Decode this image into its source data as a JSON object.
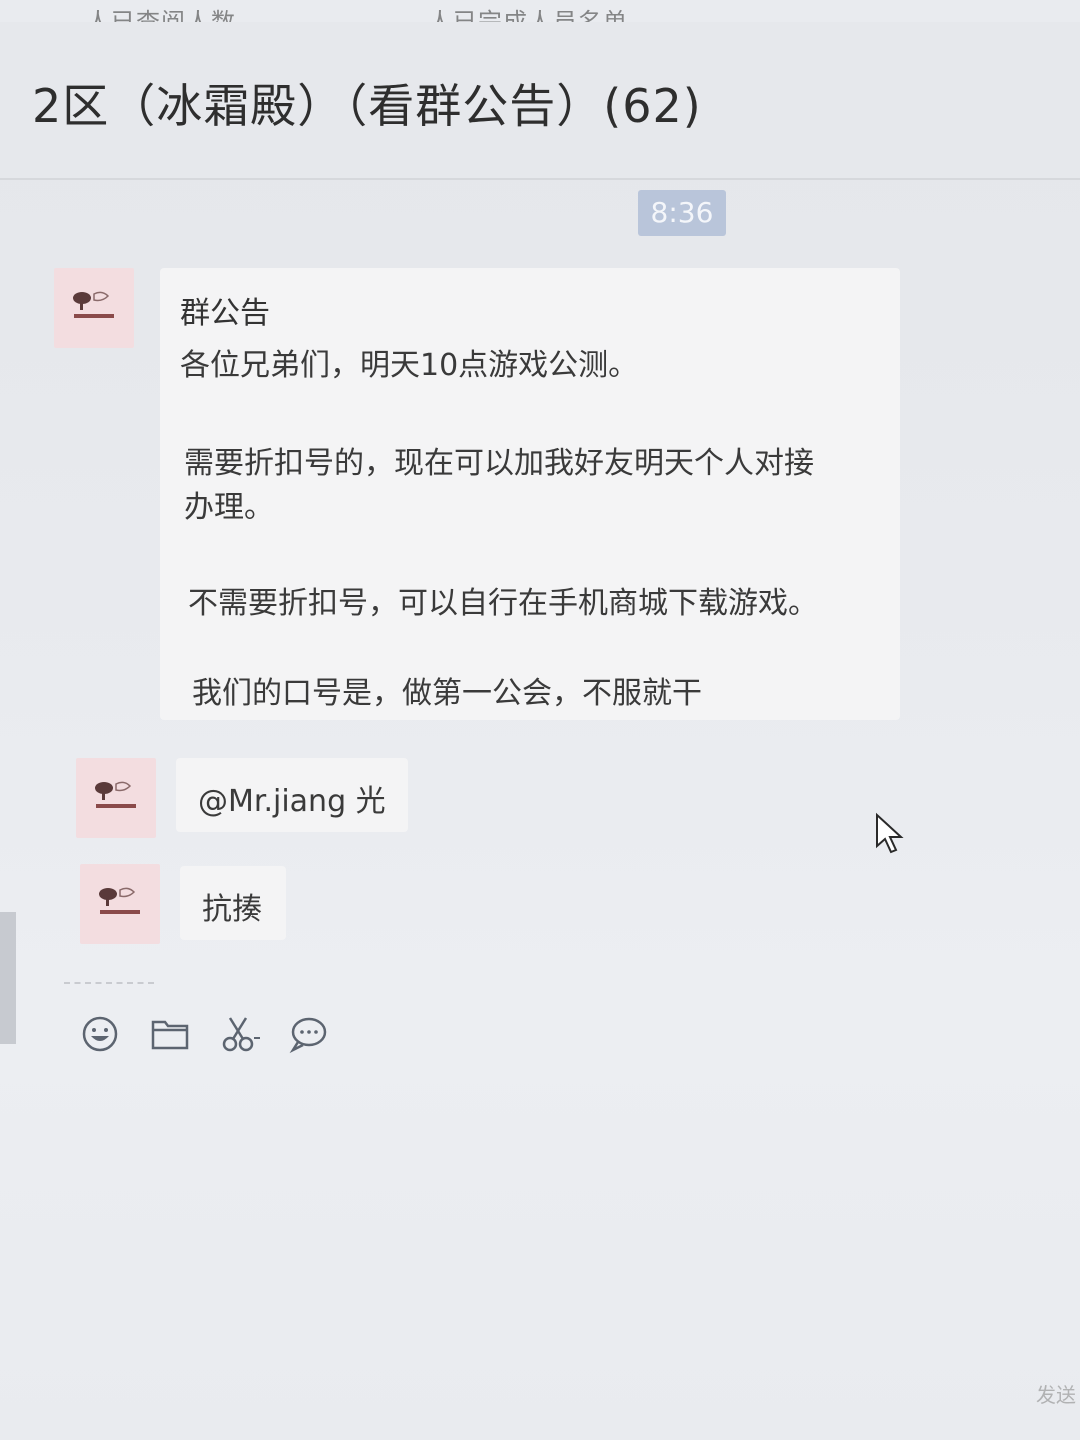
{
  "top_strip": {
    "left_text": "人已查阅人数",
    "right_text": "人已完成人员名单"
  },
  "chat": {
    "title": "2区（冰霜殿）（看群公告）(62)",
    "time": "8:36"
  },
  "announcement": {
    "heading": "群公告",
    "lines": [
      "各位兄弟们，明天10点游戏公测。",
      "需要折扣号的，现在可以加我好友明天个人对接",
      "办理。",
      "不需要折扣号，可以自行在手机商城下载游戏。",
      "我们的口号是，做第一公会，不服就干"
    ]
  },
  "messages": [
    {
      "text": "@Mr.jiang 光"
    },
    {
      "text": "抗揍"
    }
  ],
  "toolbar": {
    "icons": [
      "emoji-icon",
      "folder-icon",
      "scissors-icon",
      "chat-bubble-icon"
    ]
  },
  "corner": {
    "text": "发送"
  },
  "colors": {
    "time_badge": "#b9c5da",
    "avatar_bg": "#f3dde0",
    "bubble_bg": "#f4f4f5"
  }
}
